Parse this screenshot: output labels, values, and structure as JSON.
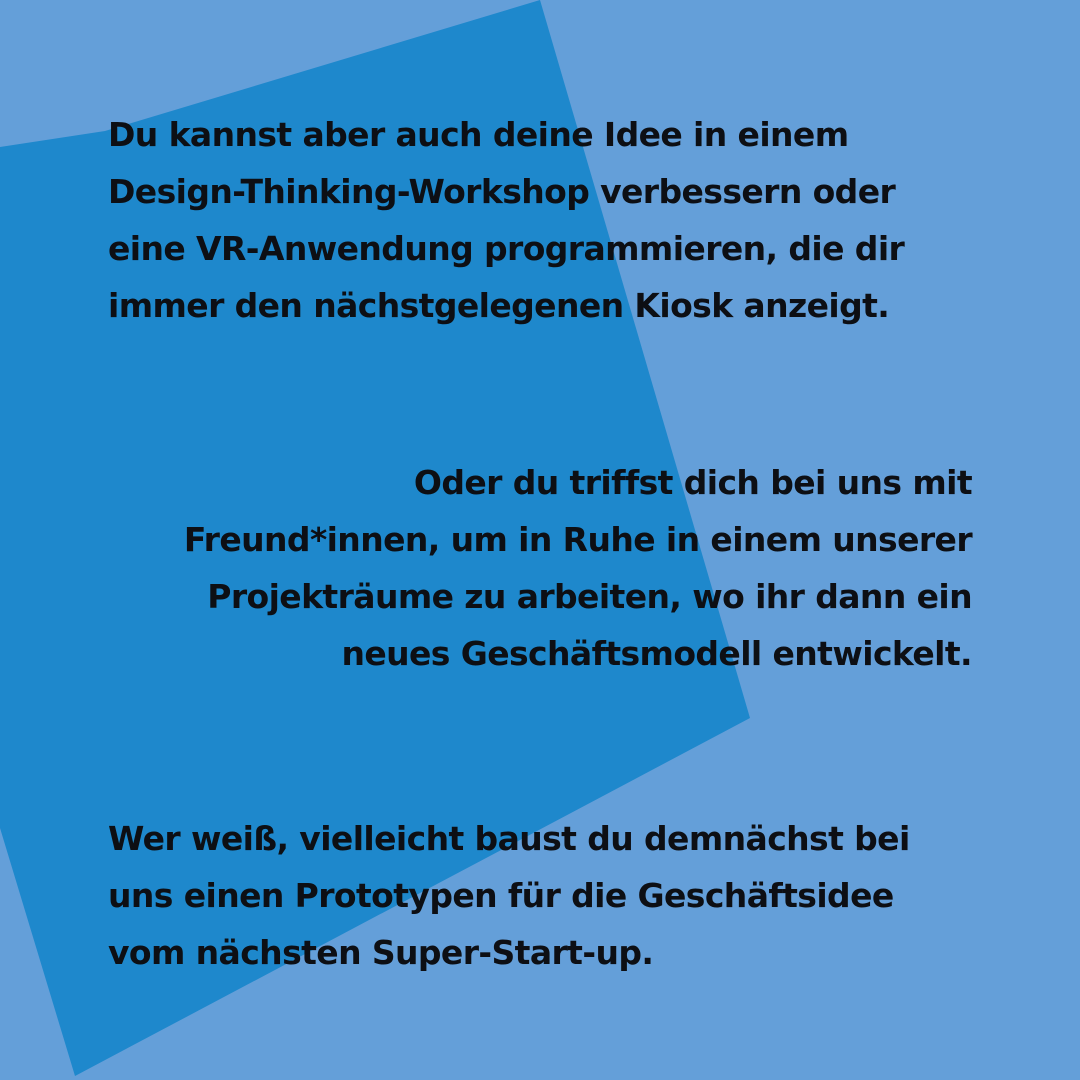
{
  "colors": {
    "background": "#649fd9",
    "shape": "#1e88cc",
    "text": "#0d0f14"
  },
  "paragraphs": {
    "first": {
      "lines": [
        "Du kannst aber auch deine Idee in einem",
        "Design-Thinking-Workshop verbessern oder",
        "eine VR-Anwendung programmieren, die dir",
        "immer den nächstgelegenen Kiosk anzeigt."
      ]
    },
    "second": {
      "lines": [
        "Oder du triffst dich bei uns mit",
        "Freund*innen, um in Ruhe in einem unserer",
        "Projekträume zu arbeiten, wo ihr dann ein",
        "neues Geschäftsmodell entwickelt."
      ]
    },
    "third": {
      "lines": [
        "Wer weiß, vielleicht baust du demnächst bei",
        "uns einen Prototypen für die Geschäftsidee",
        "vom nächsten Super-Start-up."
      ]
    }
  }
}
